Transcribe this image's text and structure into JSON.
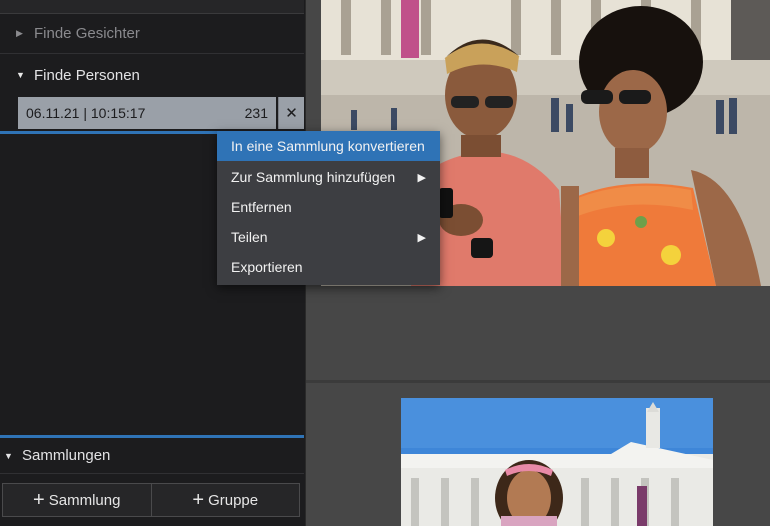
{
  "sidebar": {
    "faces_label": "Finde Gesichter",
    "persons_label": "Finde Personen",
    "search_item": {
      "date": "06.11.21 | 10:15:17",
      "count": "231"
    },
    "close_glyph": "✕",
    "collections_label": "Sammlungen",
    "buttons": {
      "collection": "Sammlung",
      "group": "Gruppe"
    }
  },
  "context_menu": {
    "items": [
      {
        "label": "In eine Sammlung konvertieren",
        "active": true,
        "submenu": false
      },
      {
        "label": "Zur Sammlung hinzufügen",
        "active": false,
        "submenu": true
      },
      {
        "label": "Entfernen",
        "active": false,
        "submenu": false
      },
      {
        "label": "Teilen",
        "active": false,
        "submenu": true
      },
      {
        "label": "Exportieren",
        "active": false,
        "submenu": false
      }
    ]
  },
  "icons": {
    "collapsed": "chevron-right-icon",
    "expanded": "chevron-down-icon",
    "plus": "plus-icon",
    "submenu": "submenu-arrow-icon"
  },
  "colors": {
    "accent": "#2f73b6",
    "panel": "#1c1c1e",
    "menu": "#3d3e42",
    "selection": "#9aa0a8"
  }
}
